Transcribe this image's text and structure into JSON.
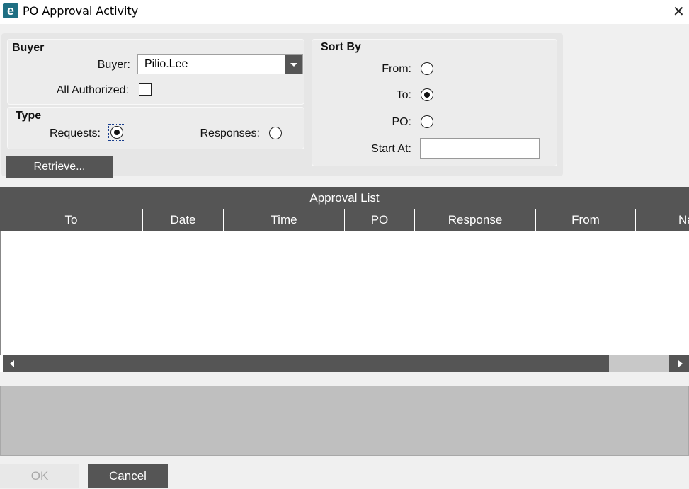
{
  "window": {
    "title": "PO Approval Activity",
    "app_icon_glyph": "e",
    "close_glyph": "✕"
  },
  "buyer_group": {
    "title": "Buyer",
    "buyer_label": "Buyer:",
    "buyer_value": "Pilio.Lee",
    "all_authorized_label": "All Authorized:",
    "all_authorized_checked": false
  },
  "type_group": {
    "title": "Type",
    "requests_label": "Requests:",
    "responses_label": "Responses:",
    "selected": "Requests"
  },
  "sort_group": {
    "title": "Sort By",
    "from_label": "From:",
    "to_label": "To:",
    "po_label": "PO:",
    "start_at_label": "Start At:",
    "start_at_value": "",
    "selected": "To"
  },
  "retrieve_button": "Retrieve...",
  "approval_list": {
    "title": "Approval List",
    "columns": [
      "To",
      "Date",
      "Time",
      "PO",
      "Response",
      "From",
      "Na"
    ],
    "rows": []
  },
  "footer": {
    "ok_label": "OK",
    "cancel_label": "Cancel"
  },
  "colors": {
    "header_bg": "#555555",
    "app_icon": "#1f6f83",
    "panel_bg": "#e6e6e6"
  }
}
